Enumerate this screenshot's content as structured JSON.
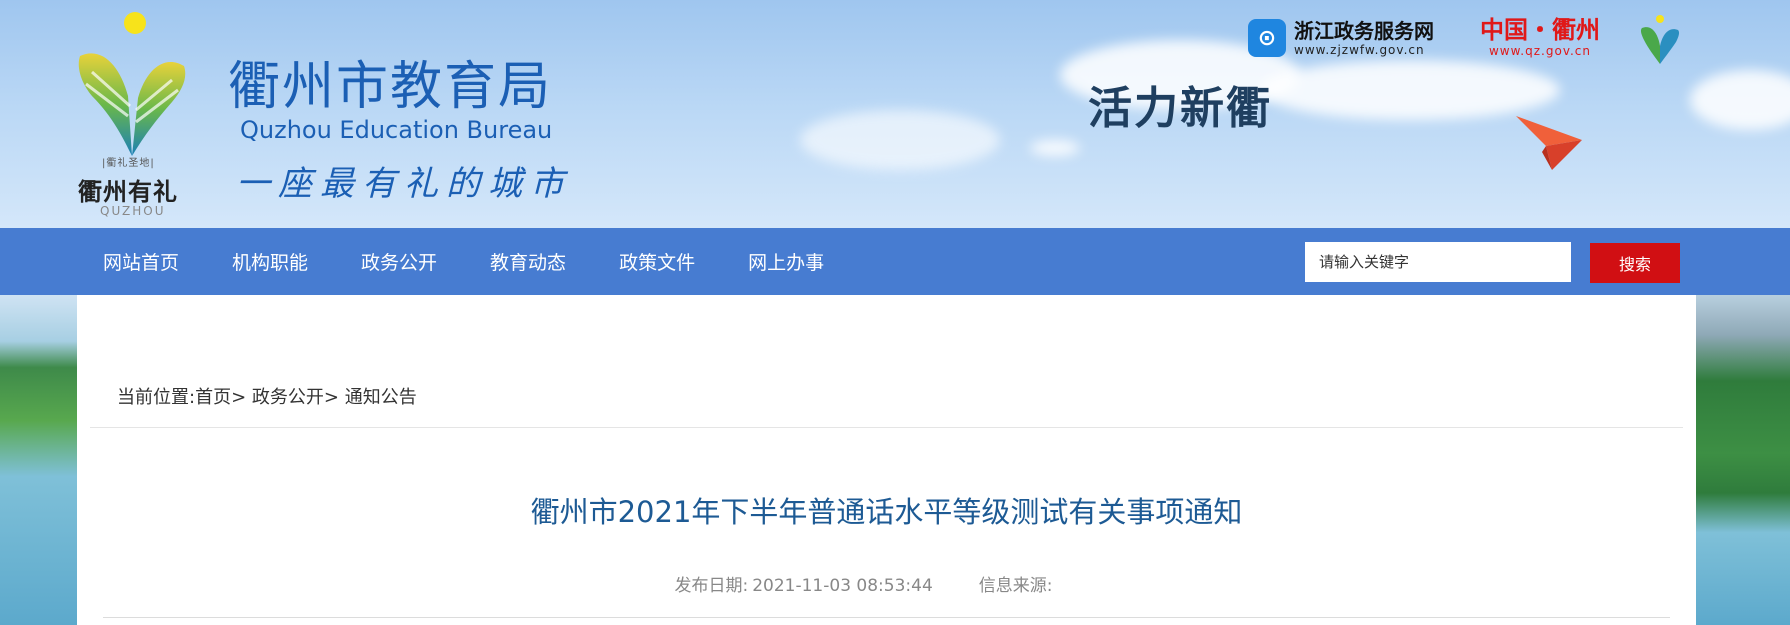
{
  "header": {
    "bureau_title": "衢州市教育局",
    "bureau_subtitle": "Quzhou Education Bureau",
    "slogan": "一座最有礼的城市",
    "emblem_small_text": "|衢礼圣地|",
    "emblem_name": "衢州有礼",
    "emblem_en": "QUZHOU",
    "vitality_text": "活力新衢",
    "links": {
      "zj_name": "浙江政务服务网",
      "zj_url": "www.zjzwfw.gov.cn",
      "qz_name": "中国・衢州",
      "qz_url": "www.qz.gov.cn"
    }
  },
  "nav": {
    "items": [
      "网站首页",
      "机构职能",
      "政务公开",
      "教育动态",
      "政策文件",
      "网上办事"
    ],
    "search_placeholder": "请输入关键字",
    "search_button": "搜索"
  },
  "breadcrumb": {
    "prefix": "当前位置:",
    "items": [
      "首页",
      "政务公开",
      "通知公告"
    ],
    "separator": ">"
  },
  "article": {
    "title": "衢州市2021年下半年普通话水平等级测试有关事项通知",
    "publish_label": "发布日期:",
    "publish_date": "2021-11-03 08:53:44",
    "source_label": "信息来源:",
    "source_value": ""
  },
  "colors": {
    "nav_bg": "#477cd1",
    "search_button": "#d10f13",
    "title_blue": "#1d5a94",
    "brand_blue": "#1b5fb4",
    "qz_red": "#e01818"
  }
}
